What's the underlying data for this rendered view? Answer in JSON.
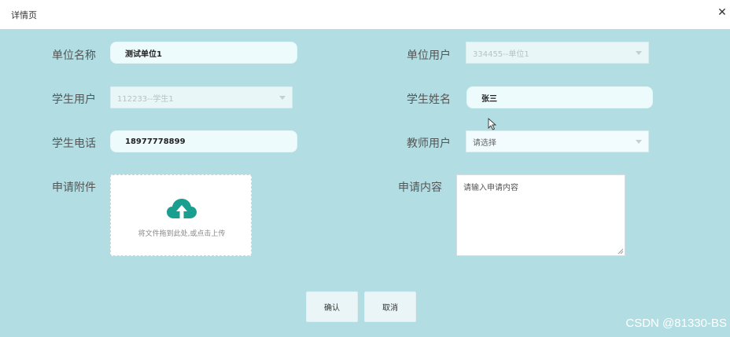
{
  "window": {
    "title": "详情页",
    "close_label": "✕"
  },
  "form": {
    "unit_name": {
      "label": "单位名称",
      "value": "测试单位1"
    },
    "unit_user": {
      "label": "单位用户",
      "value": "334455--单位1"
    },
    "student_user": {
      "label": "学生用户",
      "value": "112233--学生1"
    },
    "student_name": {
      "label": "学生姓名",
      "value": "张三"
    },
    "student_phone": {
      "label": "学生电话",
      "value": "18977778899"
    },
    "teacher_user": {
      "label": "教师用户",
      "placeholder": "请选择"
    },
    "attachment": {
      "label": "申请附件",
      "hint": "将文件拖到此处,或点击上传"
    },
    "content": {
      "label": "申请内容",
      "placeholder": "请输入申请内容"
    }
  },
  "buttons": {
    "confirm": "确认",
    "cancel": "取消"
  },
  "watermark": "CSDN @81330-BS",
  "colors": {
    "background": "#b1dde3",
    "upload_icon": "#1a9e8f"
  },
  "icons": {
    "close": "close-icon",
    "upload": "cloud-upload-icon",
    "dropdown": "chevron-down-icon"
  }
}
